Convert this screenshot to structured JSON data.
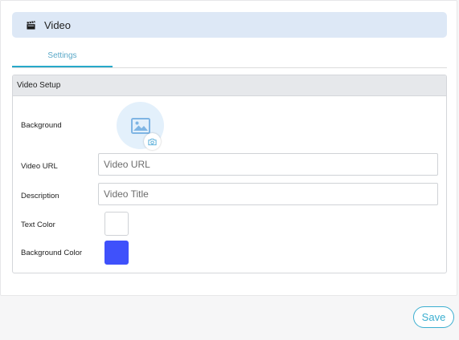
{
  "header": {
    "title": "Video",
    "icon": "clapperboard-icon"
  },
  "tabs": [
    {
      "label": "Settings",
      "active": true
    }
  ],
  "panel": {
    "title": "Video Setup",
    "background_label": "Background",
    "video_url": {
      "label": "Video URL",
      "placeholder": "Video URL",
      "value": ""
    },
    "description": {
      "label": "Description",
      "placeholder": "Video Title",
      "value": ""
    },
    "text_color": {
      "label": "Text Color",
      "value": "#ffffff"
    },
    "background_color": {
      "label": "Background Color",
      "value": "#3f51fb"
    }
  },
  "footer": {
    "save_label": "Save"
  },
  "colors": {
    "accent": "#3aaed0",
    "header_bg": "#dde8f6",
    "panel_head_bg": "#e6e8eb"
  }
}
